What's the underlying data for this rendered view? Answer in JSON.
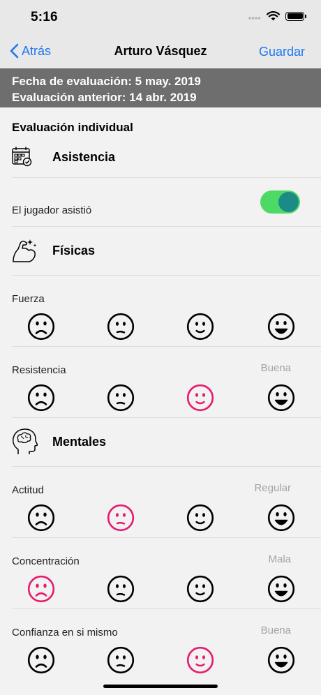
{
  "status_bar": {
    "time": "5:16"
  },
  "nav": {
    "back_label": "Atrás",
    "title": "Arturo Vásquez",
    "save_label": "Guardar"
  },
  "header": {
    "evaluation_date": "Fecha de evaluación: 5 may. 2019",
    "previous_evaluation": "Evaluación anterior: 14 abr. 2019"
  },
  "section_title": "Evaluación individual",
  "colors": {
    "accent": "#1a78f2",
    "selected_face": "#e8196e",
    "toggle_on": "#4cd964",
    "header_bg": "#6e6e6e"
  },
  "categories": [
    {
      "label": "Asistencia",
      "icon": "calendar-icon",
      "items": [
        {
          "label": "El jugador asistió",
          "type": "toggle",
          "on": true
        }
      ]
    },
    {
      "label": "Físicas",
      "icon": "flexed-arm-icon",
      "items": [
        {
          "label": "Fuerza",
          "value": "",
          "selected": -1
        },
        {
          "label": "Resistencia",
          "value": "Buena",
          "selected": 2
        }
      ]
    },
    {
      "label": "Mentales",
      "icon": "brain-head-icon",
      "items": [
        {
          "label": "Actitud",
          "value": "Regular",
          "selected": 1
        },
        {
          "label": "Concentración",
          "value": "Mala",
          "selected": 0
        },
        {
          "label": "Confianza en si mismo",
          "value": "Buena",
          "selected": 2
        }
      ]
    }
  ],
  "face_scale": [
    "sad-face-icon",
    "neutral-face-icon",
    "smile-face-icon",
    "grin-face-icon"
  ]
}
